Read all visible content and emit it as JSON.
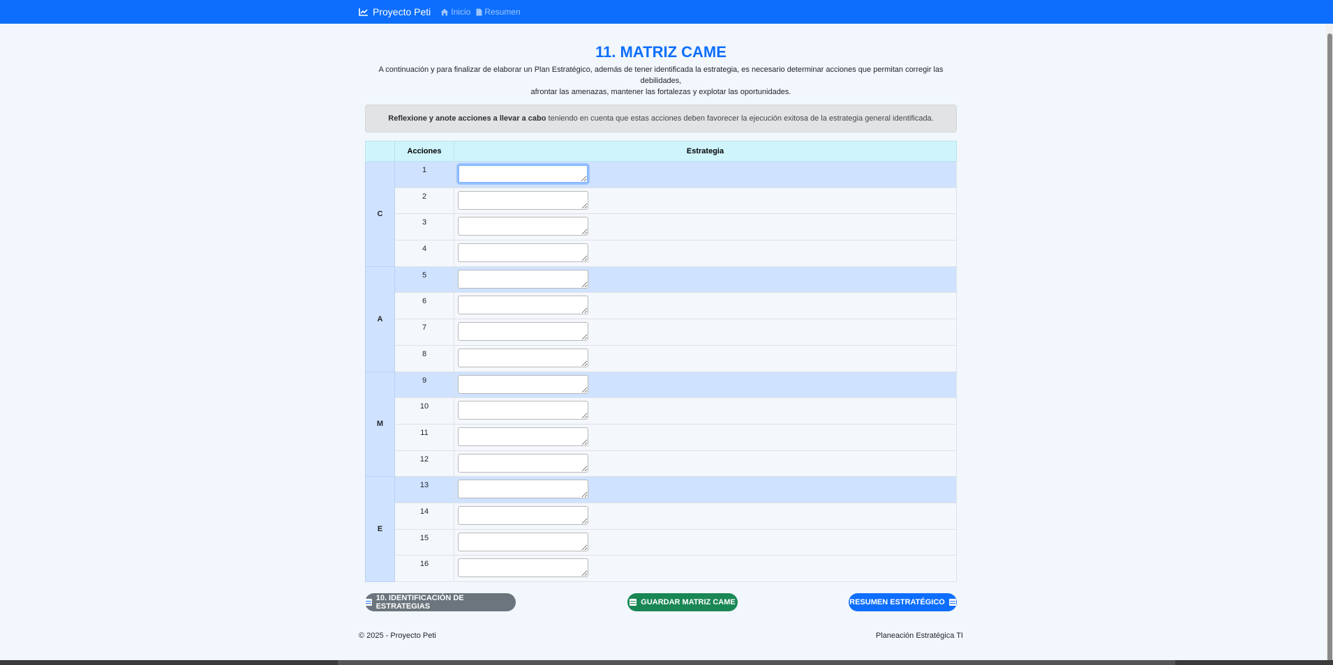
{
  "nav": {
    "brand": "Proyecto Peti",
    "links": [
      {
        "label": "Inicio",
        "icon": "home-icon"
      },
      {
        "label": "Resumen",
        "icon": "document-icon"
      }
    ]
  },
  "page": {
    "title": "11. MATRIZ CAME",
    "intro_line1": "A continuación y para finalizar de elaborar un Plan Estratégico, además de tener identificada la estrategia, es necesario determinar acciones que permitan corregir las debilidades,",
    "intro_line2": "afrontar las amenazas, mantener las fortalezas y explotar las oportunidades.",
    "alert_bold": "Reflexione y anote acciones a llevar a cabo",
    "alert_rest": " teniendo en cuenta que estas acciones deben favorecer la ejecución exitosa de la estrategia general identificada."
  },
  "table": {
    "headers": [
      "",
      "Acciones",
      "Estrategia"
    ],
    "groups": [
      {
        "letter": "C",
        "rows": [
          "1",
          "2",
          "3",
          "4"
        ]
      },
      {
        "letter": "A",
        "rows": [
          "5",
          "6",
          "7",
          "8"
        ]
      },
      {
        "letter": "M",
        "rows": [
          "9",
          "10",
          "11",
          "12"
        ]
      },
      {
        "letter": "E",
        "rows": [
          "13",
          "14",
          "15",
          "16"
        ]
      }
    ]
  },
  "buttons": {
    "prev": "10. IDENTIFICACIÓN DE ESTRATEGIAS",
    "save": "GUARDAR MATRIZ CAME",
    "next": "RESUMEN ESTRATÉGICO"
  },
  "footer": {
    "left": "© 2025 - Proyecto Peti",
    "right": "Planeación Estratégica TI"
  },
  "colors": {
    "primary": "#0d6efd",
    "success": "#198754",
    "secondary": "#6c757d",
    "header_cell": "#cff4fc",
    "group_cell": "#cfe2ff"
  }
}
